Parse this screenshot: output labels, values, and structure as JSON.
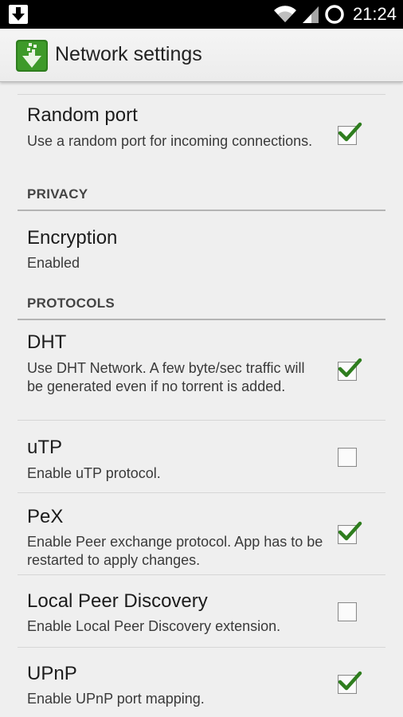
{
  "status_bar": {
    "time": "21:24",
    "icons": [
      "download-icon",
      "wifi-icon",
      "signal-icon",
      "battery-icon"
    ]
  },
  "action_bar": {
    "title": "Network settings",
    "app_icon": "app-logo-icon"
  },
  "accent_color": "#2e7d1e",
  "preferences": [
    {
      "title": "Random port",
      "summary": "Use a random port for incoming connections.",
      "checked": true
    },
    {
      "category": "PRIVACY"
    },
    {
      "title": "Encryption",
      "summary": "Enabled"
    },
    {
      "category": "PROTOCOLS"
    },
    {
      "title": "DHT",
      "summary": "Use DHT Network. A few byte/sec traffic will be generated even if no torrent is added.",
      "checked": true
    },
    {
      "title": "uTP",
      "summary": "Enable uTP protocol.",
      "checked": false
    },
    {
      "title": "PeX",
      "summary": "Enable Peer exchange protocol. App has to be restarted to apply changes.",
      "checked": true
    },
    {
      "title": "Local Peer Discovery",
      "summary": "Enable Local Peer Discovery extension.",
      "checked": false
    },
    {
      "title": "UPnP",
      "summary": "Enable UPnP port mapping.",
      "checked": true
    }
  ]
}
